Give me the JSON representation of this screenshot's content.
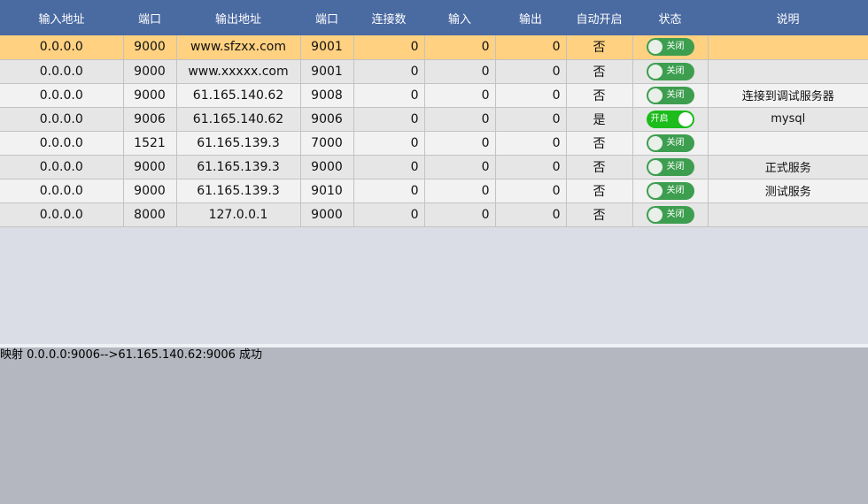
{
  "table": {
    "columns": [
      {
        "key": "in_addr",
        "label": "输入地址"
      },
      {
        "key": "in_port",
        "label": "端口"
      },
      {
        "key": "out_addr",
        "label": "输出地址"
      },
      {
        "key": "out_port",
        "label": "端口"
      },
      {
        "key": "connections",
        "label": "连接数"
      },
      {
        "key": "input",
        "label": "输入"
      },
      {
        "key": "output",
        "label": "输出"
      },
      {
        "key": "auto_start",
        "label": "自动开启"
      },
      {
        "key": "status",
        "label": "状态"
      },
      {
        "key": "description",
        "label": "说明"
      }
    ],
    "rows": [
      {
        "in_addr": "0.0.0.0",
        "in_port": "9000",
        "out_addr": "www.sfzxx.com",
        "out_port": "9001",
        "connections": "0",
        "input": "0",
        "output": "0",
        "auto_start": "否",
        "status_on": false,
        "status_label": "关闭",
        "description": "",
        "selected": true
      },
      {
        "in_addr": "0.0.0.0",
        "in_port": "9000",
        "out_addr": "www.xxxxx.com",
        "out_port": "9001",
        "connections": "0",
        "input": "0",
        "output": "0",
        "auto_start": "否",
        "status_on": false,
        "status_label": "关闭",
        "description": "",
        "selected": false
      },
      {
        "in_addr": "0.0.0.0",
        "in_port": "9000",
        "out_addr": "61.165.140.62",
        "out_port": "9008",
        "connections": "0",
        "input": "0",
        "output": "0",
        "auto_start": "否",
        "status_on": false,
        "status_label": "关闭",
        "description": "连接到调试服务器",
        "selected": false
      },
      {
        "in_addr": "0.0.0.0",
        "in_port": "9006",
        "out_addr": "61.165.140.62",
        "out_port": "9006",
        "connections": "0",
        "input": "0",
        "output": "0",
        "auto_start": "是",
        "status_on": true,
        "status_label": "开启",
        "description": "mysql",
        "selected": false
      },
      {
        "in_addr": "0.0.0.0",
        "in_port": "1521",
        "out_addr": "61.165.139.3",
        "out_port": "7000",
        "connections": "0",
        "input": "0",
        "output": "0",
        "auto_start": "否",
        "status_on": false,
        "status_label": "关闭",
        "description": "",
        "selected": false
      },
      {
        "in_addr": "0.0.0.0",
        "in_port": "9000",
        "out_addr": "61.165.139.3",
        "out_port": "9000",
        "connections": "0",
        "input": "0",
        "output": "0",
        "auto_start": "否",
        "status_on": false,
        "status_label": "关闭",
        "description": "正式服务",
        "selected": false
      },
      {
        "in_addr": "0.0.0.0",
        "in_port": "9000",
        "out_addr": "61.165.139.3",
        "out_port": "9010",
        "connections": "0",
        "input": "0",
        "output": "0",
        "auto_start": "否",
        "status_on": false,
        "status_label": "关闭",
        "description": "测试服务",
        "selected": false
      },
      {
        "in_addr": "0.0.0.0",
        "in_port": "8000",
        "out_addr": "127.0.0.1",
        "out_port": "9000",
        "connections": "0",
        "input": "0",
        "output": "0",
        "auto_start": "否",
        "status_on": false,
        "status_label": "关闭",
        "description": "",
        "selected": false
      }
    ]
  },
  "log": {
    "lines": [
      "映射 0.0.0.0:9006-->61.165.140.62:9006 成功"
    ]
  },
  "colors": {
    "header_bg": "#4a6aa2",
    "selected_row": "#ffd180",
    "toggle_off": "#3d9e4f",
    "toggle_on": "#1bbc1b"
  }
}
